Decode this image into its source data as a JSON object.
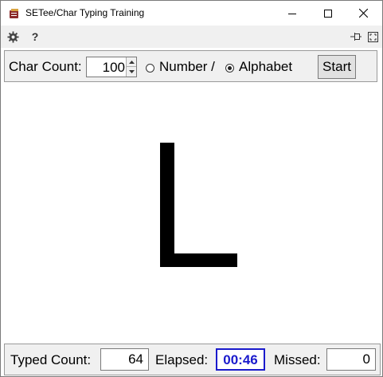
{
  "window": {
    "title": "SETee/Char Typing Training"
  },
  "toolbar": {
    "settings_icon": "gear-icon",
    "help_label": "?",
    "pin_icon": "pin-icon",
    "fullscreen_icon": "fullscreen-icon"
  },
  "settings": {
    "char_count_label": "Char Count:",
    "char_count_value": "100",
    "mode_options": [
      {
        "label": "Number /",
        "selected": false
      },
      {
        "label": "Alphabet",
        "selected": true
      }
    ],
    "start_label": "Start"
  },
  "display": {
    "current_char": "L"
  },
  "status": {
    "typed_label": "Typed Count:",
    "typed_value": "64",
    "elapsed_label": "Elapsed:",
    "elapsed_value": "00:46",
    "missed_label": "Missed:",
    "missed_value": "0"
  },
  "colors": {
    "elapsed_text": "#1a1acc",
    "window_bg": "#ffffff",
    "panel_bg": "#f0f0f0"
  }
}
